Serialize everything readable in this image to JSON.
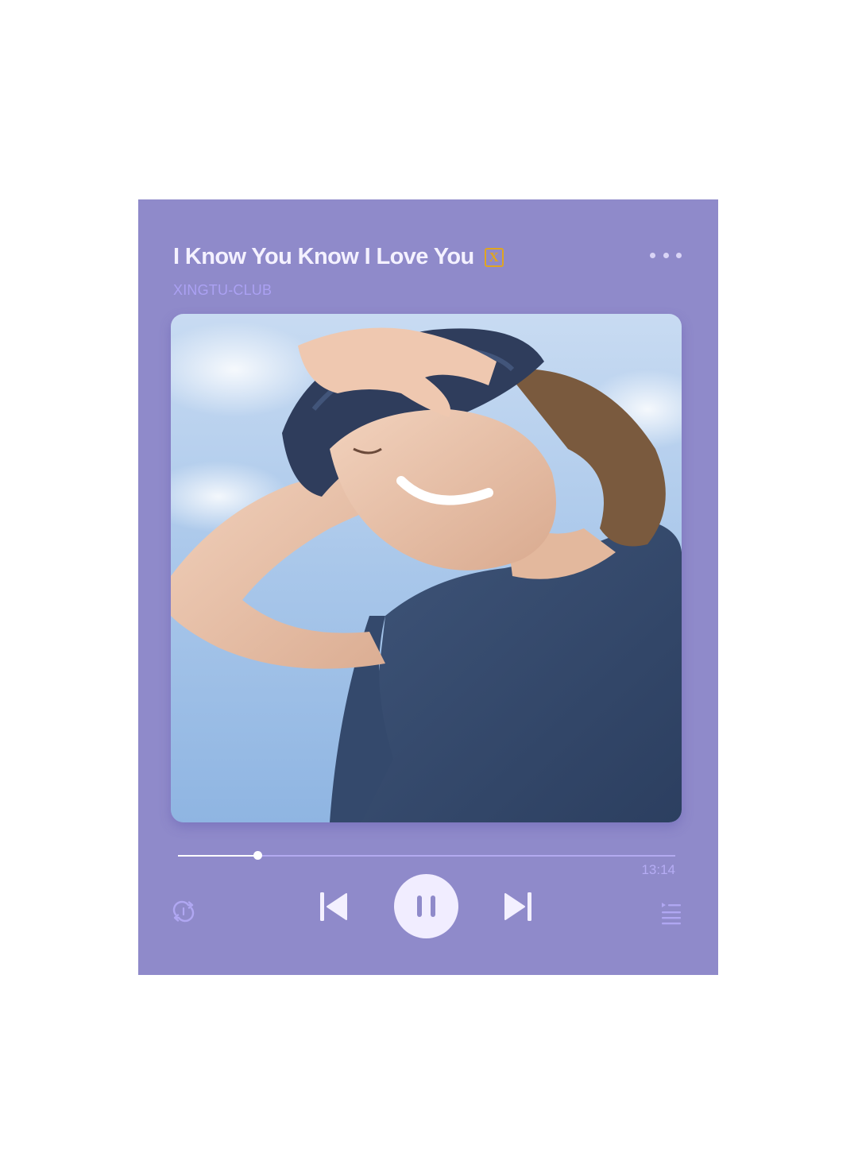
{
  "player": {
    "song_title": "I Know You Know I Love You",
    "vip_badge": "X",
    "artist": "XINGTU-CLUB",
    "duration": "13:14",
    "progress": 0.16
  },
  "colors": {
    "card_background": "#8f8aca",
    "title": "#f4f1ff",
    "artist": "#aba1f3",
    "badge": "#e0a520",
    "play_button": "#f1edff"
  },
  "icons": {
    "more": "more-dots-icon",
    "repeat": "repeat-icon",
    "previous": "skip-previous-icon",
    "pause": "pause-icon",
    "next": "skip-next-icon",
    "playlist": "playlist-icon"
  }
}
